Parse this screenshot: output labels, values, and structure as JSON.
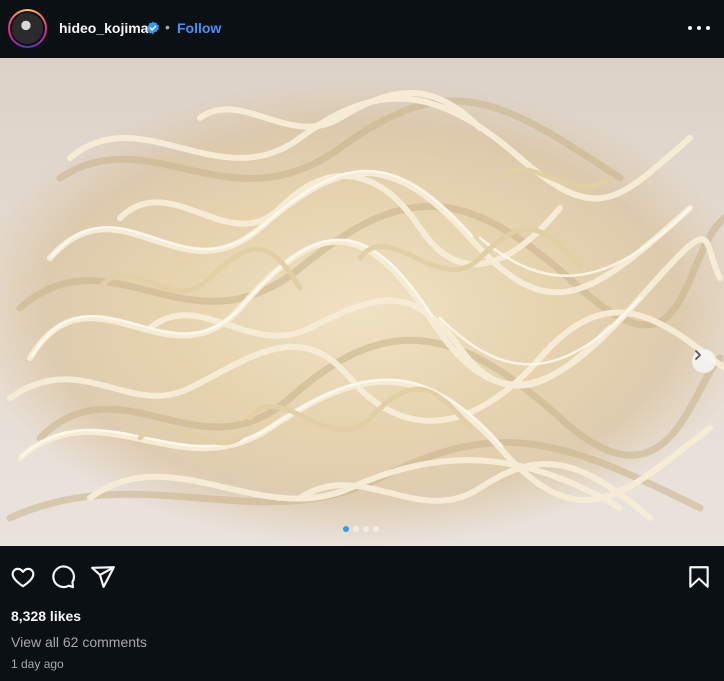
{
  "post": {
    "username": "hideo_kojima",
    "verified": true,
    "separator": "•",
    "follow_label": "Follow",
    "media": {
      "slide_count": 4,
      "active_slide": 1,
      "subject_icon": "noodles-photo"
    },
    "likes_text": "8,328 likes",
    "comments_text": "View all 62 comments",
    "time_text": "1 day ago"
  },
  "icons": {
    "more": "more-horizontal-icon",
    "like": "heart-icon",
    "comment": "comment-icon",
    "share": "share-icon",
    "save": "bookmark-icon",
    "next": "chevron-right-icon",
    "verified": "verified-badge-icon"
  },
  "colors": {
    "background": "#0b1014",
    "link_blue": "#4a8ff7",
    "verified_blue": "#3897f0",
    "muted_text": "#a8a8a8"
  }
}
